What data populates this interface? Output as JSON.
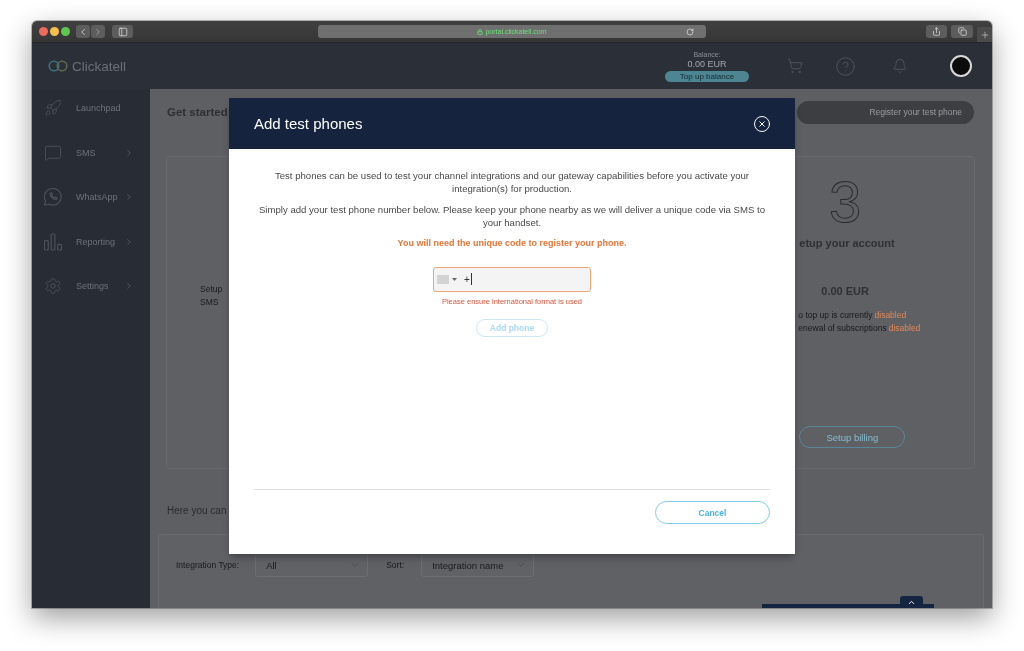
{
  "browser": {
    "url": "portal.clickatell.com"
  },
  "header": {
    "logo": "Clickatell",
    "balance_label": "Balance:",
    "balance": "0.00 EUR",
    "top_up_button": "Top up balance"
  },
  "sidebar": {
    "items": [
      {
        "label": "Launchpad",
        "kind": "link"
      },
      {
        "label": "SMS",
        "kind": "menu"
      },
      {
        "label": "WhatsApp",
        "kind": "menu"
      },
      {
        "label": "Reporting",
        "kind": "menu"
      },
      {
        "label": "Settings",
        "kind": "menu"
      }
    ]
  },
  "main": {
    "title": "Get started",
    "register_button": "Register your test phone",
    "left_card": {
      "lines": [
        "Setup",
        "SMS"
      ]
    },
    "right_card": {
      "step": "3",
      "title": "etup your account",
      "amount": "0.00 EUR",
      "settings": [
        {
          "text": "o top up is currently",
          "status": "disabled"
        },
        {
          "text": "enewal of subscriptions",
          "status": "disabled"
        }
      ],
      "button": "Setup billing"
    },
    "intro": "Here you can",
    "filters": {
      "type_label": "Integration Type:",
      "type_value": "All",
      "sort_label": "Sort:",
      "sort_value": "Integration name"
    }
  },
  "modal": {
    "title": "Add test phones",
    "paragraphs": [
      "Test phones can be used to test your channel integrations and our gateway capabilities before you activate your integration(s) for production.",
      "Simply add your test phone number below. Please keep your phone nearby as we will deliver a unique code via SMS to your handset."
    ],
    "notice": "You will need the unique code to register your phone.",
    "phone_field": {
      "value": "+",
      "invalid": true
    },
    "error": "Please ensure international format is used",
    "add_button": {
      "label": "Add phone",
      "disabled": true
    },
    "cancel_button": "Cancel"
  }
}
